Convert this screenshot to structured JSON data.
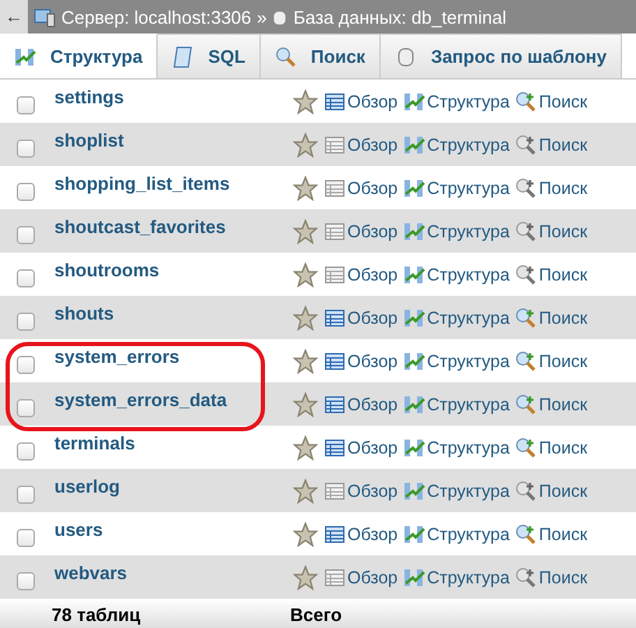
{
  "breadcrumb": {
    "back": "←",
    "server": "Сервер: localhost:3306",
    "separator": "»",
    "database": "База данных: db_terminal"
  },
  "tabs": [
    {
      "label": "Структура",
      "selected": true
    },
    {
      "label": "SQL",
      "selected": false
    },
    {
      "label": "Поиск",
      "selected": false
    },
    {
      "label": "Запрос по шаблону",
      "selected": false
    }
  ],
  "rows": [
    {
      "checked": false,
      "name": "settings",
      "has_data": true,
      "circled": false,
      "browse": "Обзор",
      "structure": "Структура",
      "search": "Поиск"
    },
    {
      "checked": false,
      "name": "shoplist",
      "has_data": false,
      "circled": false,
      "browse": "Обзор",
      "structure": "Структура",
      "search": "Поиск"
    },
    {
      "checked": false,
      "name": "shopping_list_items",
      "has_data": false,
      "circled": false,
      "browse": "Обзор",
      "structure": "Структура",
      "search": "Поиск"
    },
    {
      "checked": false,
      "name": "shoutcast_favorites",
      "has_data": false,
      "circled": false,
      "browse": "Обзор",
      "structure": "Структура",
      "search": "Поиск"
    },
    {
      "checked": false,
      "name": "shoutrooms",
      "has_data": false,
      "circled": false,
      "browse": "Обзор",
      "structure": "Структура",
      "search": "Поиск"
    },
    {
      "checked": false,
      "name": "shouts",
      "has_data": true,
      "circled": false,
      "browse": "Обзор",
      "structure": "Структура",
      "search": "Поиск"
    },
    {
      "checked": false,
      "name": "system_errors",
      "has_data": true,
      "circled": true,
      "browse": "Обзор",
      "structure": "Структура",
      "search": "Поиск"
    },
    {
      "checked": false,
      "name": "system_errors_data",
      "has_data": true,
      "circled": true,
      "browse": "Обзор",
      "structure": "Структура",
      "search": "Поиск"
    },
    {
      "checked": false,
      "name": "terminals",
      "has_data": true,
      "circled": false,
      "browse": "Обзор",
      "structure": "Структура",
      "search": "Поиск"
    },
    {
      "checked": false,
      "name": "userlog",
      "has_data": false,
      "circled": false,
      "browse": "Обзор",
      "structure": "Структура",
      "search": "Поиск"
    },
    {
      "checked": false,
      "name": "users",
      "has_data": true,
      "circled": false,
      "browse": "Обзор",
      "structure": "Структура",
      "search": "Поиск"
    },
    {
      "checked": false,
      "name": "webvars",
      "has_data": false,
      "circled": false,
      "browse": "Обзор",
      "structure": "Структура",
      "search": "Поиск"
    }
  ],
  "footer": {
    "count": "78 таблиц",
    "total": "Всего"
  }
}
